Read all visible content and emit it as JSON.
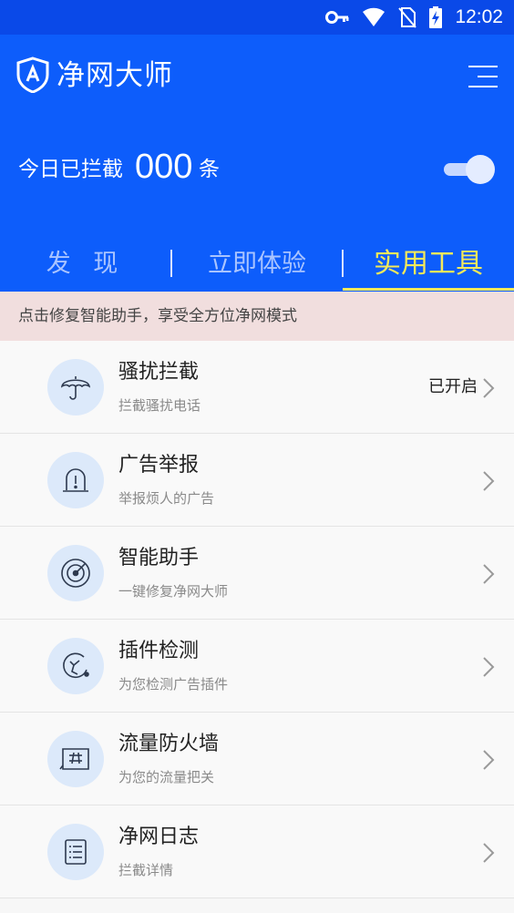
{
  "status_bar": {
    "time": "12:02"
  },
  "app": {
    "title": "净网大师"
  },
  "counter": {
    "label": "今日已拦截",
    "value": "000",
    "unit": "条",
    "enabled": true
  },
  "tabs": [
    {
      "label": "发 现",
      "active": false
    },
    {
      "label": "立即体验",
      "active": false
    },
    {
      "label": "实用工具",
      "active": true
    }
  ],
  "banner": {
    "text": "点击修复智能助手，享受全方位净网模式"
  },
  "tools": [
    {
      "title": "骚扰拦截",
      "subtitle": "拦截骚扰电话",
      "status": "已开启",
      "icon": "umbrella-icon"
    },
    {
      "title": "广告举报",
      "subtitle": "举报烦人的广告",
      "status": "",
      "icon": "alert-icon"
    },
    {
      "title": "智能助手",
      "subtitle": "一键修复净网大师",
      "status": "",
      "icon": "radar-icon"
    },
    {
      "title": "插件检测",
      "subtitle": "为您检测广告插件",
      "status": "",
      "icon": "plugin-icon"
    },
    {
      "title": "流量防火墙",
      "subtitle": "为您的流量把关",
      "status": "",
      "icon": "firewall-icon"
    },
    {
      "title": "净网日志",
      "subtitle": "拦截详情",
      "status": "",
      "icon": "log-icon"
    }
  ],
  "colors": {
    "header": "#0d5dfb",
    "active_tab": "#f4e95a",
    "banner_bg": "#f1dede",
    "icon_bg": "#dce9fa"
  }
}
